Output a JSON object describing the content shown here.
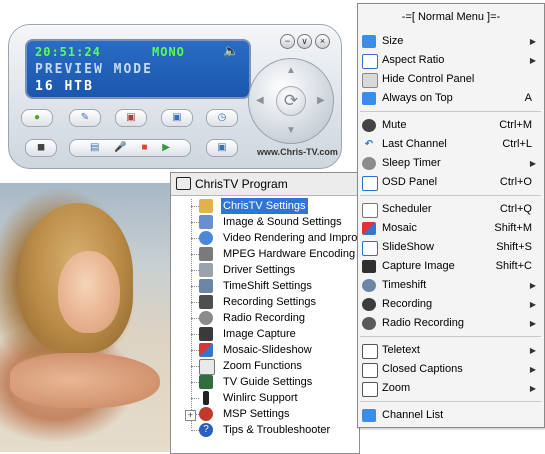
{
  "panel": {
    "time": "20:51:24",
    "audio_mode": "MONO",
    "mode_text": "PREVIEW MODE",
    "channel_text": "16 HTB",
    "website": "www.Chris-TV.com",
    "minimize_symbol": "−",
    "options_symbol": "∨",
    "close_symbol": "×",
    "accent_lcd": "#1a57ad",
    "lcd_green": "#57ff57"
  },
  "program_window": {
    "title": "ChrisTV Program",
    "items": [
      {
        "label": "ChrisTV Settings",
        "icon": "settings-icon",
        "selected": true
      },
      {
        "label": "Image & Sound Settings",
        "icon": "image-sound-icon"
      },
      {
        "label": "Video Rendering and Impro",
        "icon": "video-rendering-icon"
      },
      {
        "label": "MPEG Hardware Encoding",
        "icon": "mpeg-icon"
      },
      {
        "label": "Driver Settings",
        "icon": "driver-icon"
      },
      {
        "label": "TimeShift Settings",
        "icon": "timeshift-icon"
      },
      {
        "label": "Recording Settings",
        "icon": "recording-icon"
      },
      {
        "label": "Radio Recording",
        "icon": "radio-icon"
      },
      {
        "label": "Image Capture",
        "icon": "camera-icon"
      },
      {
        "label": "Mosaic-Slideshow",
        "icon": "mosaic-icon"
      },
      {
        "label": "Zoom Functions",
        "icon": "zoom-icon"
      },
      {
        "label": "TV Guide Settings",
        "icon": "tv-guide-icon"
      },
      {
        "label": "Winlirc Support",
        "icon": "remote-icon"
      },
      {
        "label": "MSP Settings",
        "icon": "msp-icon",
        "expandable": true
      },
      {
        "label": "Tips & Troubleshooter",
        "icon": "help-icon"
      }
    ]
  },
  "menu": {
    "header": "-=[ Normal Menu ]=-",
    "items": [
      {
        "label": "Size",
        "shortcut": "",
        "submenu": true,
        "icon": "monitor-icon"
      },
      {
        "label": "Aspect Ratio",
        "shortcut": "",
        "submenu": true,
        "icon": "aspect-ratio-icon"
      },
      {
        "label": "Hide Control Panel",
        "shortcut": "",
        "submenu": false,
        "icon": "hide-panel-icon"
      },
      {
        "label": "Always on Top",
        "shortcut": "A",
        "submenu": false,
        "icon": "always-on-top-icon"
      },
      {
        "label": "Mute",
        "shortcut": "Ctrl+M",
        "submenu": false,
        "icon": "mute-icon"
      },
      {
        "label": "Last Channel",
        "shortcut": "Ctrl+L",
        "submenu": false,
        "icon": "last-channel-icon"
      },
      {
        "label": "Sleep Timer",
        "shortcut": "",
        "submenu": true,
        "icon": "sleep-timer-icon"
      },
      {
        "label": "OSD Panel",
        "shortcut": "Ctrl+O",
        "submenu": false,
        "icon": "osd-panel-icon"
      },
      {
        "label": "Scheduler",
        "shortcut": "Ctrl+Q",
        "submenu": false,
        "icon": "scheduler-icon"
      },
      {
        "label": "Mosaic",
        "shortcut": "Shift+M",
        "submenu": false,
        "icon": "mosaic-icon"
      },
      {
        "label": "SlideShow",
        "shortcut": "Shift+S",
        "submenu": false,
        "icon": "slideshow-icon"
      },
      {
        "label": "Capture Image",
        "shortcut": "Shift+C",
        "submenu": false,
        "icon": "camera-icon"
      },
      {
        "label": "Timeshift",
        "shortcut": "",
        "submenu": true,
        "icon": "timeshift-icon"
      },
      {
        "label": "Recording",
        "shortcut": "",
        "submenu": true,
        "icon": "record-icon"
      },
      {
        "label": "Radio Recording",
        "shortcut": "",
        "submenu": true,
        "icon": "radio-icon"
      },
      {
        "label": "Teletext",
        "shortcut": "",
        "submenu": true,
        "icon": "teletext-icon"
      },
      {
        "label": "Closed Captions",
        "shortcut": "",
        "submenu": true,
        "icon": "closed-captions-icon"
      },
      {
        "label": "Zoom",
        "shortcut": "",
        "submenu": true,
        "icon": "zoom-icon"
      },
      {
        "label": "Channel List",
        "shortcut": "",
        "submenu": false,
        "icon": "channel-list-icon"
      }
    ]
  }
}
